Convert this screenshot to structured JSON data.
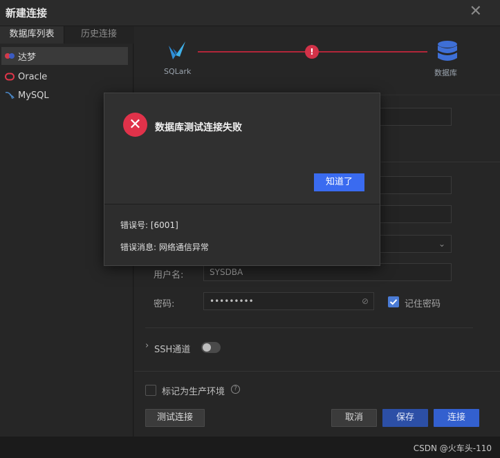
{
  "window": {
    "title": "新建连接",
    "close_icon": "close-icon"
  },
  "sidebar": {
    "tabs": [
      {
        "label": "数据库列表"
      },
      {
        "label": "历史连接"
      }
    ],
    "items": [
      {
        "label": "达梦",
        "icon": "dameng-icon"
      },
      {
        "label": "Oracle",
        "icon": "oracle-icon"
      },
      {
        "label": "MySQL",
        "icon": "mysql-icon"
      }
    ]
  },
  "steps": {
    "start_label": "SQLark",
    "end_label": "数据库",
    "error_mark": "!"
  },
  "form": {
    "username_label": "用户名:",
    "username_value": "SYSDBA",
    "password_label": "密码:",
    "password_value": "•••••••••",
    "remember_label": "记住密码",
    "ssh_label": "SSH通道",
    "production_label": "标记为生产环境",
    "help_icon": "?"
  },
  "buttons": {
    "test": "测试连接",
    "cancel": "取消",
    "save": "保存",
    "connect": "连接"
  },
  "colors": {
    "accent_blue": "#3a6bf0",
    "error_red": "#e0324a",
    "primary_button": "#2c4fa6"
  },
  "modal": {
    "title": "数据库测试连接失败",
    "ok_label": "知道了",
    "error_code": "错误号: [6001]",
    "error_message": "错误消息: 网络通信异常",
    "icon": "error-circle-icon"
  },
  "watermark": "CSDN @火车头-110"
}
